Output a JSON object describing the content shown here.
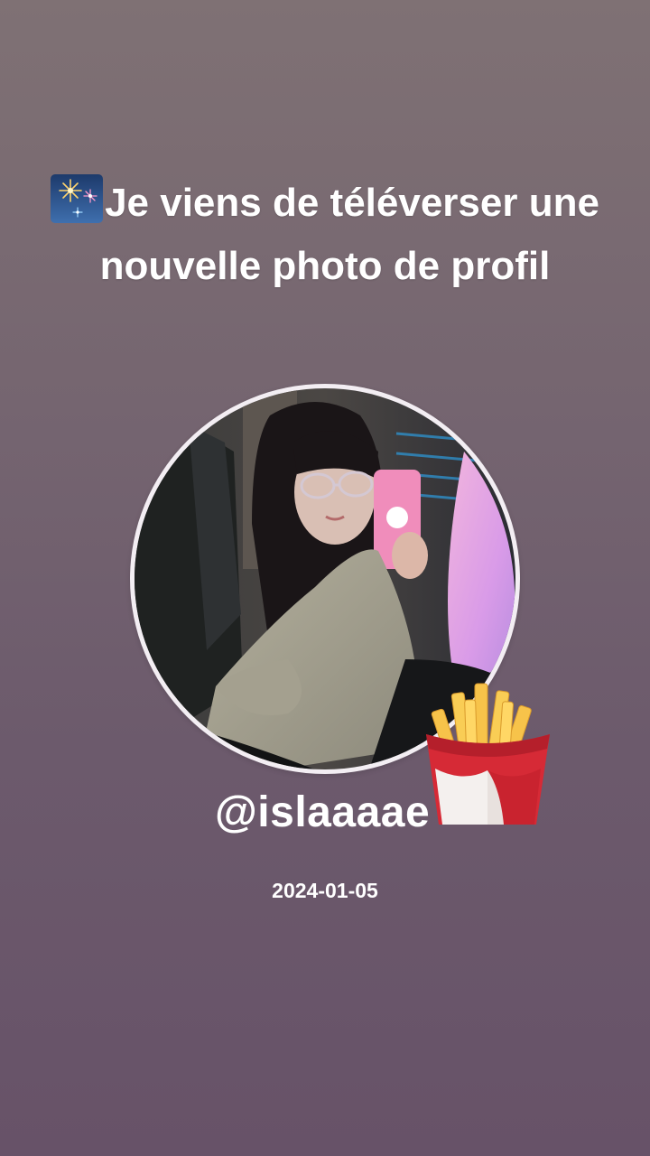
{
  "post": {
    "title": "Je viens de téléverser une nouvelle photo de profil",
    "title_icon": "fireworks-icon",
    "avatar_description_icon": "profile-photo",
    "sticker_icon": "french-fries-icon",
    "username": "@islaaaae",
    "date": "2024-01-05"
  },
  "colors": {
    "background_top": "#7f7174",
    "background_bottom": "#675268",
    "text": "#ffffff",
    "avatar_ring": "#f3eef3"
  }
}
